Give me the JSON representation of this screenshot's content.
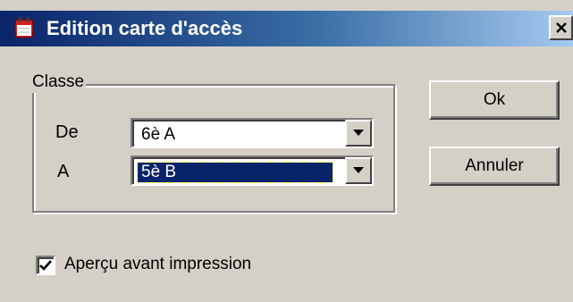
{
  "window": {
    "title": "Edition carte d'accès",
    "close_glyph": "X",
    "colors": {
      "title_active": "#0a246a",
      "face": "#d4d0c8",
      "selection": "#0a246a"
    }
  },
  "classe": {
    "legend": "Classe",
    "de_label": "De",
    "de_value": "6è A",
    "a_label": "A",
    "a_value": "5è B"
  },
  "buttons": {
    "ok_label": "Ok",
    "cancel_label": "Annuler"
  },
  "preview": {
    "label": "Aperçu avant impression",
    "checked": true
  },
  "icons": {
    "title": "calendar-icon",
    "close": "close-icon",
    "dropdown": "chevron-down-icon",
    "check": "check-icon"
  }
}
